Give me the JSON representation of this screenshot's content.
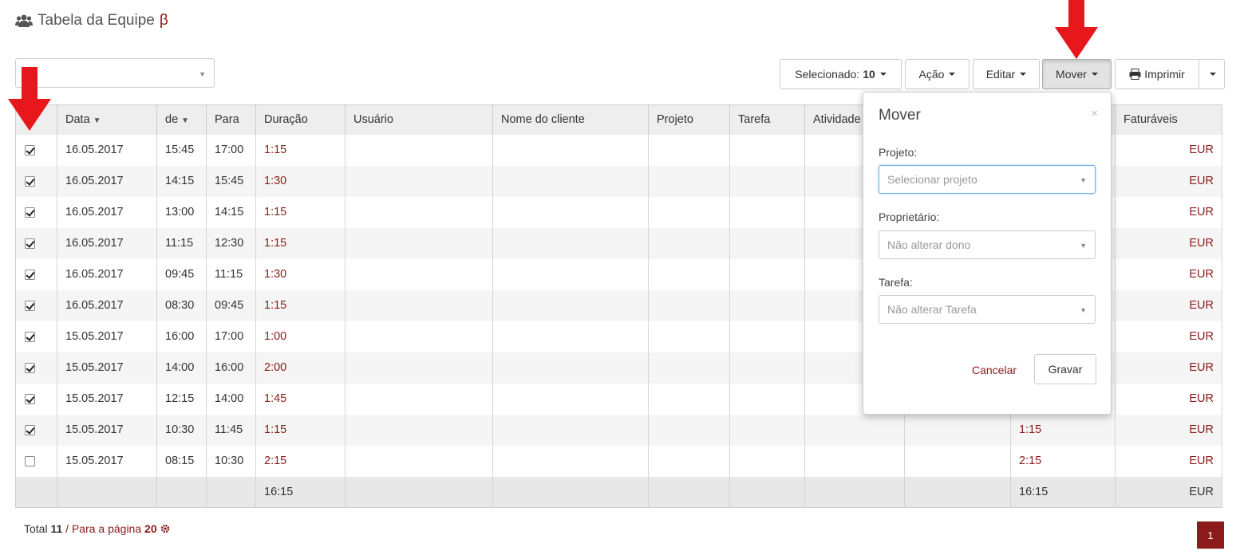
{
  "page": {
    "title": "Tabela da Equipe",
    "beta": "β"
  },
  "toolbar": {
    "selected_label": "Selecionado:",
    "selected_count": "10",
    "action": "Ação",
    "edit": "Editar",
    "move": "Mover",
    "print": "Imprimir"
  },
  "table": {
    "headers": [
      "Data",
      "de",
      "Para",
      "Duração",
      "Usuário",
      "Nome do cliente",
      "Projeto",
      "Tarefa",
      "Atividade",
      "",
      "",
      "Faturáveis"
    ],
    "rows": [
      {
        "checked": true,
        "date": "16.05.2017",
        "from": "15:45",
        "to": "17:00",
        "duration": "1:15",
        "dur2": "",
        "bill": "EUR"
      },
      {
        "checked": true,
        "date": "16.05.2017",
        "from": "14:15",
        "to": "15:45",
        "duration": "1:30",
        "dur2": "",
        "bill": "EUR"
      },
      {
        "checked": true,
        "date": "16.05.2017",
        "from": "13:00",
        "to": "14:15",
        "duration": "1:15",
        "dur2": "",
        "bill": "EUR"
      },
      {
        "checked": true,
        "date": "16.05.2017",
        "from": "11:15",
        "to": "12:30",
        "duration": "1:15",
        "dur2": "",
        "bill": "EUR"
      },
      {
        "checked": true,
        "date": "16.05.2017",
        "from": "09:45",
        "to": "11:15",
        "duration": "1:30",
        "dur2": "",
        "bill": "EUR"
      },
      {
        "checked": true,
        "date": "16.05.2017",
        "from": "08:30",
        "to": "09:45",
        "duration": "1:15",
        "dur2": "",
        "bill": "EUR"
      },
      {
        "checked": true,
        "date": "15.05.2017",
        "from": "16:00",
        "to": "17:00",
        "duration": "1:00",
        "dur2": "",
        "bill": "EUR"
      },
      {
        "checked": true,
        "date": "15.05.2017",
        "from": "14:00",
        "to": "16:00",
        "duration": "2:00",
        "dur2": "",
        "bill": "EUR"
      },
      {
        "checked": true,
        "date": "15.05.2017",
        "from": "12:15",
        "to": "14:00",
        "duration": "1:45",
        "dur2": "",
        "bill": "EUR"
      },
      {
        "checked": true,
        "date": "15.05.2017",
        "from": "10:30",
        "to": "11:45",
        "duration": "1:15",
        "dur2": "1:15",
        "bill": "EUR"
      },
      {
        "checked": false,
        "date": "15.05.2017",
        "from": "08:15",
        "to": "10:30",
        "duration": "2:15",
        "dur2": "2:15",
        "bill": "EUR"
      }
    ],
    "total": {
      "duration": "16:15",
      "dur2": "16:15",
      "bill": "EUR"
    }
  },
  "footer": {
    "total_label": "Total",
    "total_count": "11",
    "sep": "/",
    "per_page_label": "Para a página",
    "per_page": "20",
    "page": "1"
  },
  "popover": {
    "title": "Mover",
    "close": "×",
    "project_label": "Projeto:",
    "project_placeholder": "Selecionar projeto",
    "owner_label": "Proprietário:",
    "owner_placeholder": "Não alterar dono",
    "task_label": "Tarefa:",
    "task_placeholder": "Não alterar Tarefa",
    "cancel": "Cancelar",
    "save": "Gravar"
  },
  "colors": {
    "accent": "#8b1a1a",
    "arrow": "#e8171c"
  },
  "icons": [
    "users-icon",
    "print-icon",
    "gear-icon",
    "chevron-down-icon",
    "close-icon",
    "checkbox-icon"
  ]
}
